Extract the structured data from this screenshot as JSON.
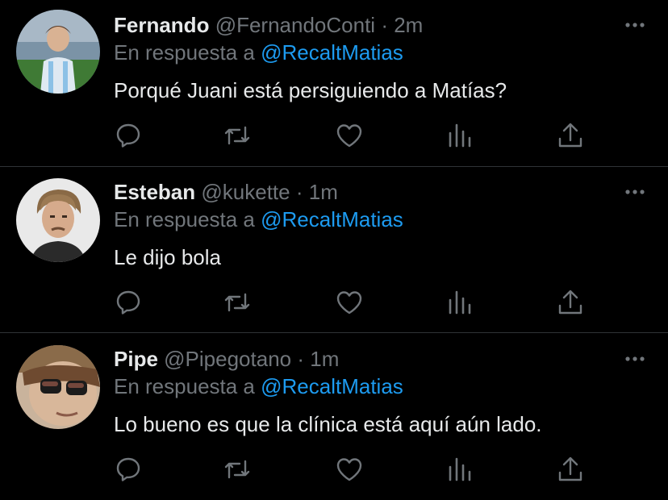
{
  "colors": {
    "background": "#000000",
    "text": "#e7e9ea",
    "muted": "#71767b",
    "link": "#1d9bf0",
    "divider": "#2f3336"
  },
  "tweets": [
    {
      "name": "Fernando",
      "handle": "@FernandoConti",
      "separator": "·",
      "time": "2m",
      "reply_prefix": "En respuesta a",
      "reply_to": "@RecaltMatias",
      "text": "Porqué Juani está persiguiendo a Matías?"
    },
    {
      "name": "Esteban",
      "handle": "@kukette",
      "separator": "·",
      "time": "1m",
      "reply_prefix": "En respuesta a",
      "reply_to": "@RecaltMatias",
      "text": "Le dijo bola"
    },
    {
      "name": "Pipe",
      "handle": "@Pipegotano",
      "separator": "·",
      "time": "1m",
      "reply_prefix": "En respuesta a",
      "reply_to": "@RecaltMatias",
      "text": "Lo bueno es que la clínica está aquí aún lado."
    }
  ],
  "icons": {
    "reply": "reply-icon",
    "retweet": "retweet-icon",
    "like": "heart-icon",
    "analytics": "analytics-icon",
    "share": "share-icon",
    "more": "more-icon"
  }
}
